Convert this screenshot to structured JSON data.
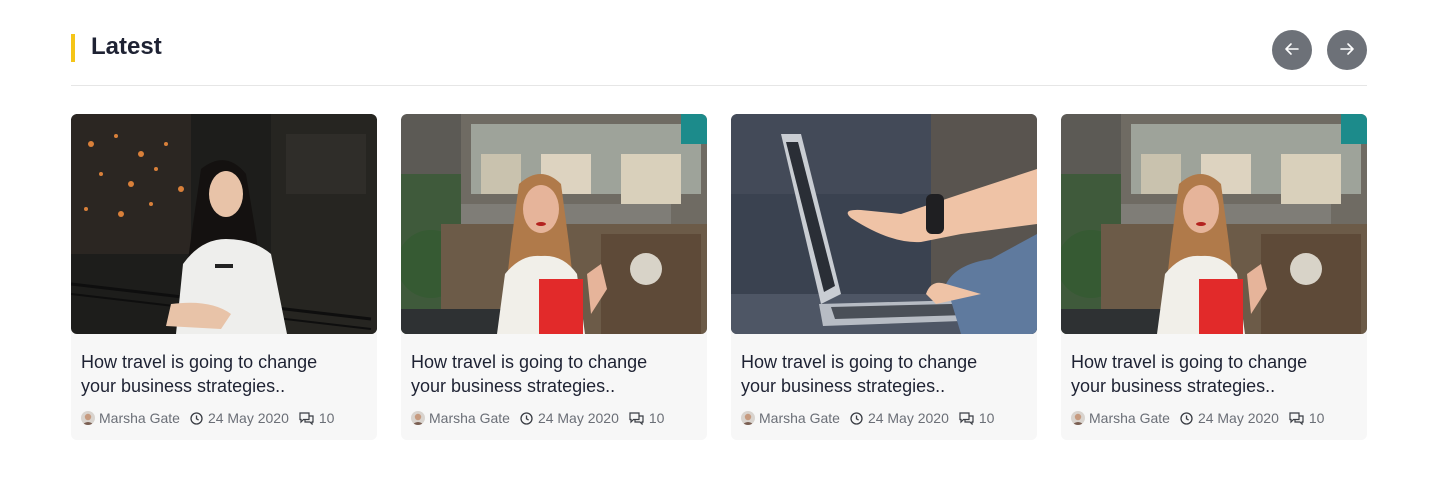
{
  "section": {
    "title": "Latest",
    "accent_color": "#f5c518"
  },
  "nav": {
    "prev_icon": "arrow-left-icon",
    "next_icon": "arrow-right-icon",
    "button_color": "#6d7178"
  },
  "posts": [
    {
      "image": "woman-night-city-photo",
      "title_line1": "How travel is going to change",
      "title_line2": "your business strategies..",
      "author": "Marsha Gate",
      "date": "24 May 2020",
      "comments": "10"
    },
    {
      "image": "woman-street-cafe-photo",
      "title_line1": "How travel is going to change",
      "title_line2": "your business strategies..",
      "author": "Marsha Gate",
      "date": "24 May 2020",
      "comments": "10"
    },
    {
      "image": "laptop-hands-photo",
      "title_line1": "How travel is going to change",
      "title_line2": "your business strategies..",
      "author": "Marsha Gate",
      "date": "24 May 2020",
      "comments": "10"
    },
    {
      "image": "woman-street-cafe-photo",
      "title_line1": "How travel is going to change",
      "title_line2": "your business strategies..",
      "author": "Marsha Gate",
      "date": "24 May 2020",
      "comments": "10"
    }
  ]
}
